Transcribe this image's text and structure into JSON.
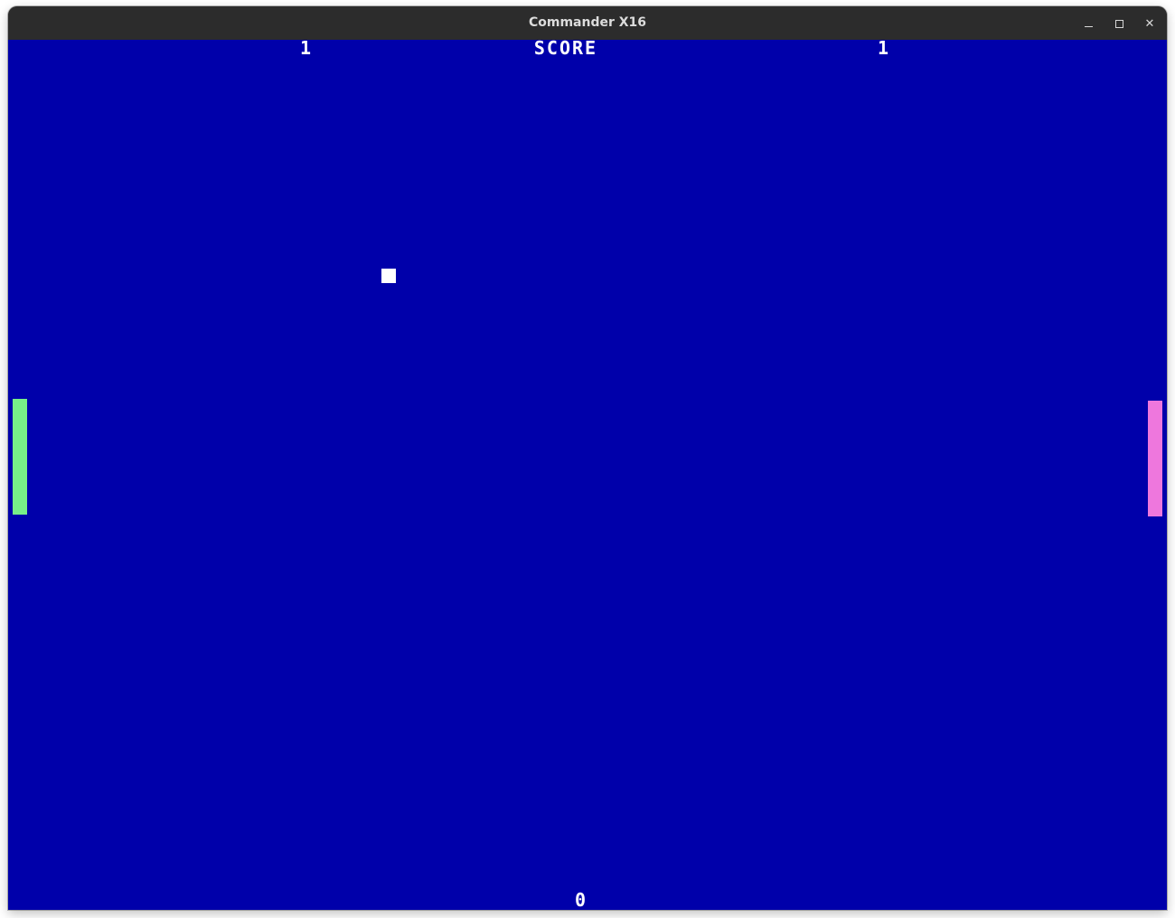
{
  "window": {
    "title": "Commander X16",
    "minimize_label": "",
    "maximize_label": "",
    "close_label": "✕"
  },
  "game": {
    "score_label": "SCORE",
    "left_score": "1",
    "right_score": "1",
    "bottom_counter": "0"
  },
  "colors": {
    "playfield": "#0000aa",
    "left_paddle": "#77ee88",
    "right_paddle": "#ee77dd",
    "ball": "#ffffff",
    "titlebar": "#2c2c2c"
  }
}
